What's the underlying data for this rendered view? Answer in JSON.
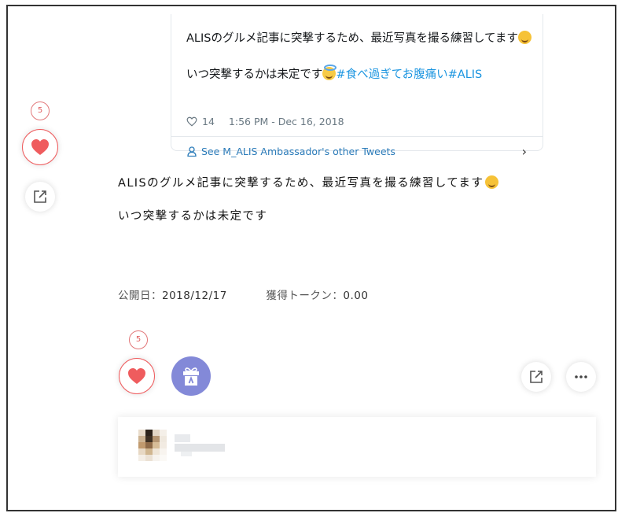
{
  "tweet": {
    "line1": "ALISのグルメ記事に突撃するため、最近写真を撮る練習してます",
    "line2": "いつ突撃するかは未定です",
    "hashtags": "#食べ過ぎてお腹痛い#ALIS",
    "likes": "14",
    "timestamp": "1:56 PM - Dec 16, 2018",
    "footer_link": "See M_ALIS Ambassador's other Tweets",
    "emoji1": "rolling-on-floor-laughing-icon",
    "emoji2": "smiling-face-with-halo-icon"
  },
  "side_actions": {
    "like_count": "5"
  },
  "article": {
    "paragraph1": "ALISのグルメ記事に突撃するため、最近写真を撮る練習してます",
    "paragraph2": "いつ突撃するかは未定です",
    "published_label": "公開日：",
    "published_value": "2018/12/17",
    "token_label": "獲得トークン：",
    "token_value": "0.00"
  },
  "bottom_actions": {
    "like_count": "5"
  },
  "colors": {
    "like_red": "#ef5c5e",
    "tip_purple": "#8389d8",
    "twitter_blue": "#1b95e0"
  }
}
